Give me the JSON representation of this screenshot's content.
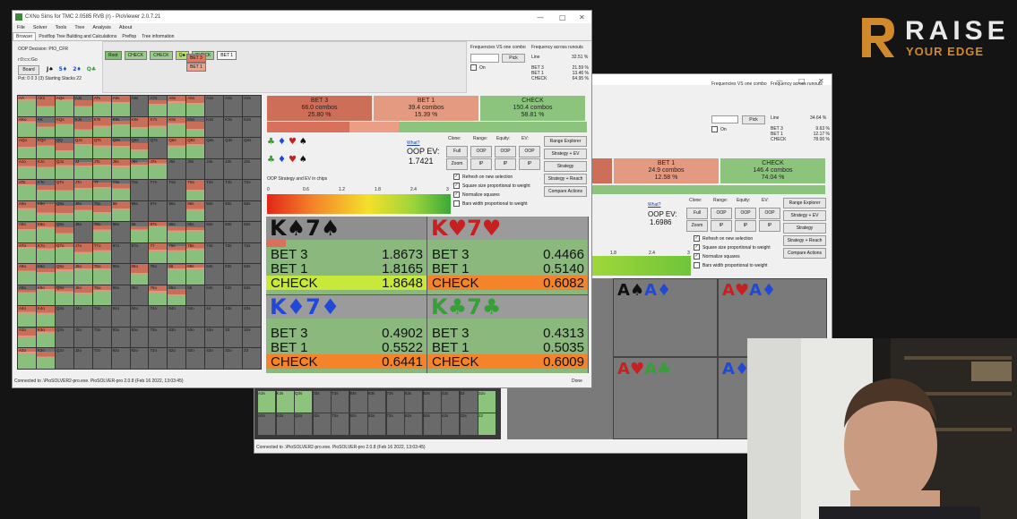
{
  "logo": {
    "brand_letter": "R",
    "brand": "RAISE",
    "tagline": "YOUR EDGE",
    "color": "#d08a2c"
  },
  "front": {
    "title": "CXNo Sims for TMC 2.0585 RVB (r) - PioViewer 2.0.7.21",
    "menu": [
      "File",
      "Solver",
      "Tools",
      "Tree",
      "Analysis",
      "About"
    ],
    "tabs": [
      "Browser",
      "Postflop Tree Building and Calculations",
      "Preflop",
      "Tree information"
    ],
    "decision": "OOP Decision:  PIO_CFR",
    "stack_info": "r:0:c:c:Go",
    "board_btn": "Board",
    "board_cards": [
      "J♠",
      "5♦",
      "2♦",
      "Q♣"
    ],
    "pot_text": "Pot: 0 0 3 (3) Starting Stacks 22",
    "tree_nodes": [
      "Root",
      "CHECK",
      "CHECK",
      "Q♣",
      "CHECK",
      "BET 1"
    ],
    "tree_sub": [
      "BET 3",
      "BET 1"
    ],
    "freq_label": "Frequencies VS one combo",
    "pick": "Pick",
    "on": "On",
    "across": "Frequency across runouts",
    "line": "Line",
    "line_pct": "32.51 %",
    "runout": [
      {
        "a": "BET 3",
        "v": "21.59 %"
      },
      {
        "a": "BET 1",
        "v": "13.46 %"
      },
      {
        "a": "CHECK",
        "v": "64.95 %"
      }
    ],
    "actions": [
      {
        "name": "BET 3",
        "combos": "66.0 combos",
        "pct": "25.80 %",
        "color": "#cd6e58"
      },
      {
        "name": "BET 1",
        "combos": "39.4 combos",
        "pct": "15.39 %",
        "color": "#e49a80"
      },
      {
        "name": "CHECK",
        "combos": "150.4 combos",
        "pct": "58.81 %",
        "color": "#8cc47e"
      }
    ],
    "what": "What?",
    "oop_ev_label": "OOP EV:",
    "oop_ev": "1.7421",
    "clone": "Clone:",
    "range": "Range:",
    "equity": "Equity:",
    "ev": "EV:",
    "btns": [
      "Full",
      "OOP",
      "OOP",
      "OOP",
      "Zoom",
      "IP",
      "IP",
      "IP"
    ],
    "side_btns": [
      "Range Explorer",
      "Strategy + EV",
      "Strategy",
      "Strategy + Reach",
      "Compare Actions"
    ],
    "checks": [
      "Refresh on new selection",
      "Square size proportional to weight",
      "Normalize squares",
      "Bars width proportional to weight"
    ],
    "checks_on": [
      true,
      true,
      true,
      false
    ],
    "scale_label": "OOP Strategy and EV in chips",
    "scale_ticks": [
      "0",
      "0.6",
      "1.2",
      "1.8",
      "2.4",
      "3"
    ],
    "card_panels": [
      {
        "rank": "K",
        "s1": "♠",
        "r2": "7",
        "s2": "♠",
        "color": "#111",
        "rows": [
          {
            "a": "BET 3",
            "v": "1.8673"
          },
          {
            "a": "BET 1",
            "v": "1.8165"
          },
          {
            "a": "CHECK",
            "v": "1.8648"
          }
        ],
        "hl": "#c8e83a"
      },
      {
        "rank": "K",
        "s1": "♥",
        "r2": "7",
        "s2": "♥",
        "color": "#c62020",
        "rows": [
          {
            "a": "BET 3",
            "v": "0.4466"
          },
          {
            "a": "BET 1",
            "v": "0.5140"
          },
          {
            "a": "CHECK",
            "v": "0.6082"
          }
        ],
        "hl": "#f4832a"
      },
      {
        "rank": "K",
        "s1": "♦",
        "r2": "7",
        "s2": "♦",
        "color": "#1f49d6",
        "rows": [
          {
            "a": "BET 3",
            "v": "0.4902"
          },
          {
            "a": "BET 1",
            "v": "0.5522"
          },
          {
            "a": "CHECK",
            "v": "0.6441"
          }
        ],
        "hl": "#f4832a"
      },
      {
        "rank": "K",
        "s1": "♣",
        "r2": "7",
        "s2": "♣",
        "color": "#35a035",
        "rows": [
          {
            "a": "BET 3",
            "v": "0.4313"
          },
          {
            "a": "BET 1",
            "v": "0.5035"
          },
          {
            "a": "CHECK",
            "v": "0.6009"
          }
        ],
        "hl": "#f4832a"
      }
    ],
    "status": "Connected to .\\PioSOLVER2-pro.exe. PioSOLVER-pro 2.0.8 (Feb 16 2022, 13:03:45)",
    "done": "Done"
  },
  "back": {
    "freq_label": "Frequencies VS one combo",
    "pick": "Pick",
    "on": "On",
    "across": "Frequency across runouts",
    "line": "Line",
    "line_pct": "34.64 %",
    "runout": [
      {
        "a": "BET 3",
        "v": "9.63 %"
      },
      {
        "a": "BET 1",
        "v": "12.17 %"
      },
      {
        "a": "CHECK",
        "v": "78.00 %"
      }
    ],
    "actions": [
      {
        "name": "BET 1",
        "combos": "24.9 combos",
        "pct": "12.58 %",
        "color": "#e49a80"
      },
      {
        "name": "CHECK",
        "combos": "146.4 combos",
        "pct": "74.04 %",
        "color": "#8cc47e"
      }
    ],
    "what": "What?",
    "oop_ev_label": "OOP EV:",
    "oop_ev": "1.6986",
    "clone": "Clone:",
    "range": "Range:",
    "equity": "Equity:",
    "ev": "EV:",
    "btns": [
      "Full",
      "OOP",
      "OOP",
      "OOP",
      "Zoom",
      "IP",
      "IP",
      "IP"
    ],
    "side_btns": [
      "Range Explorer",
      "Strategy + EV",
      "Strategy",
      "Strategy + Reach",
      "Compare Actions"
    ],
    "checks": [
      "Refresh on new selection",
      "Square size proportional to weight",
      "Normalize squares",
      "Bars width proportional to weight"
    ],
    "scale_ticks": [
      "1.8",
      "2.4",
      "3"
    ],
    "card_panels": [
      {
        "c1": "A",
        "s1": "♠",
        "c2": "A",
        "s2": "♦",
        "col1": "#111",
        "col2": "#1f49d6"
      },
      {
        "c1": "A",
        "s1": "♥",
        "c2": "A",
        "s2": "♦",
        "col1": "#c62020",
        "col2": "#1f49d6"
      },
      {
        "c1": "A",
        "s1": "♥",
        "c2": "A",
        "s2": "♣",
        "col1": "#c62020",
        "col2": "#35a035"
      },
      {
        "c1": "A",
        "s1": "♦",
        "c2": "",
        "s2": "",
        "col1": "#1f49d6",
        "col2": "#1f49d6"
      }
    ],
    "bottom_rows": [
      [
        "A3s",
        "K3s",
        "Q3s",
        "J3s",
        "T3s",
        "93s",
        "83s",
        "73s",
        "63s",
        "53s",
        "43s",
        "33",
        "32o"
      ],
      [
        "A2s",
        "K2s",
        "Q2s",
        "J2s",
        "T2s",
        "92s",
        "82s",
        "72s",
        "62s",
        "52s",
        "42s",
        "32s",
        "22"
      ]
    ],
    "status": "Connected to .\\PioSOLVER2-pro.exe. PioSOLVER-pro 2.0.8 (Feb 16 2022, 13:03:45)"
  },
  "matrix_ranks": [
    "A",
    "K",
    "Q",
    "J",
    "T",
    "9",
    "8",
    "7",
    "6",
    "5",
    "4",
    "3",
    "2"
  ]
}
